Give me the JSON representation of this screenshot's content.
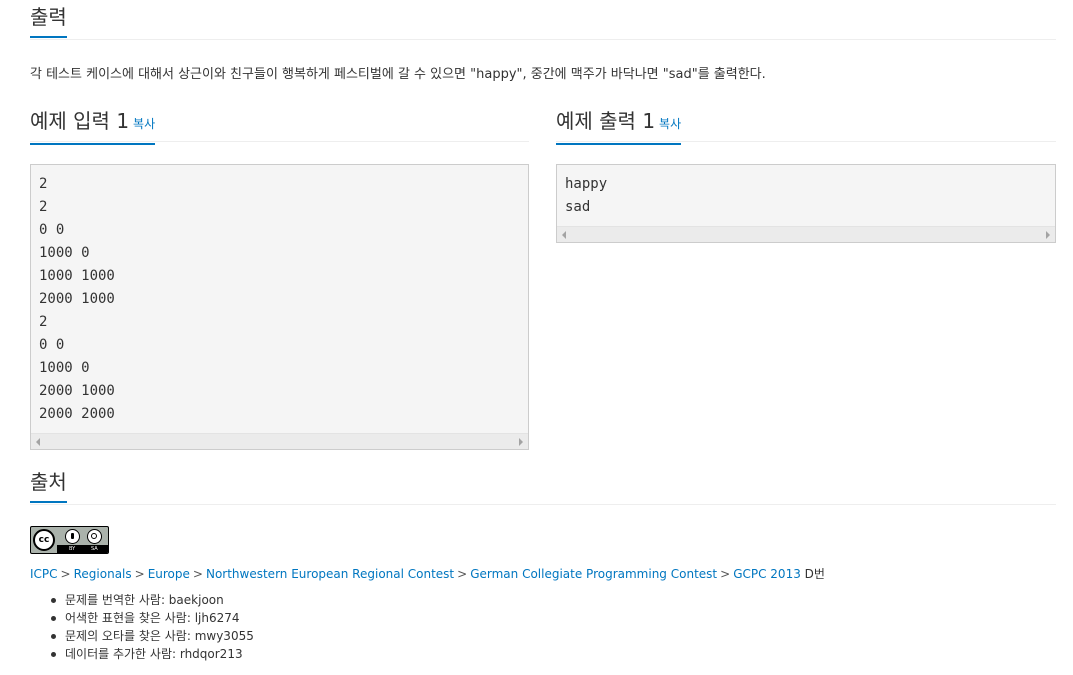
{
  "output_section": {
    "title": "출력",
    "description": "각 테스트 케이스에 대해서 상근이와 친구들이 행복하게 페스티벌에 갈 수 있으면 \"happy\", 중간에 맥주가 바닥나면 \"sad\"를 출력한다."
  },
  "sample_input": {
    "title": "예제 입력 1",
    "copy_label": "복사",
    "lines": [
      "2",
      "2",
      "0 0",
      "1000 0",
      "1000 1000",
      "2000 1000",
      "2",
      "0 0",
      "1000 0",
      "2000 1000",
      "2000 2000"
    ]
  },
  "sample_output": {
    "title": "예제 출력 1",
    "copy_label": "복사",
    "lines": [
      "happy",
      "sad"
    ]
  },
  "source_section": {
    "title": "출처",
    "license_badge": {
      "cc": "cc",
      "by": "BY",
      "sa": "SA"
    },
    "breadcrumb": [
      "ICPC",
      "Regionals",
      "Europe",
      "Northwestern European Regional Contest",
      "German Collegiate Programming Contest",
      "GCPC 2013"
    ],
    "breadcrumb_separator": ">",
    "breadcrumb_suffix": "D번",
    "credits": [
      "문제를 번역한 사람: baekjoon",
      "어색한 표현을 찾은 사람: ljh6274",
      "문제의 오타를 찾은 사람: mwy3055",
      "데이터를 추가한 사람: rhdqor213"
    ]
  },
  "colors": {
    "accent": "#0076c0",
    "text": "#333333",
    "pre_background": "#f5f5f5",
    "pre_border": "#cccccc"
  },
  "icons": {
    "scroll_left": "caret-left-icon",
    "scroll_right": "caret-right-icon",
    "license": "cc-by-sa-badge"
  }
}
